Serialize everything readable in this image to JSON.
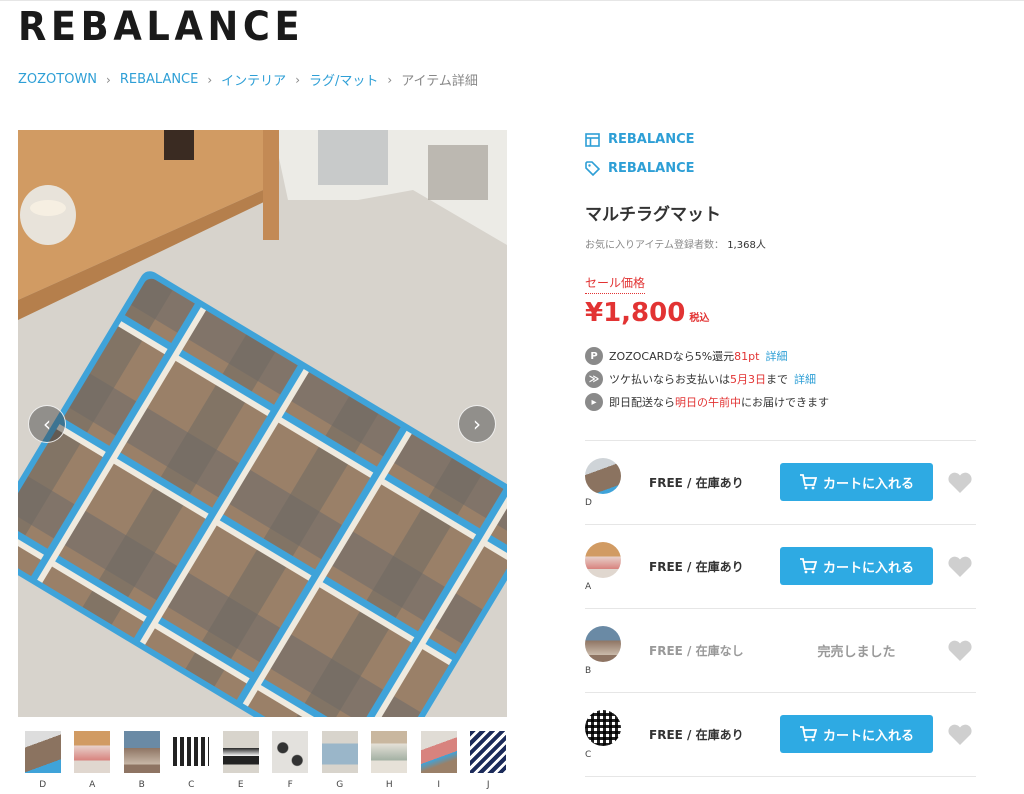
{
  "logo": "REBALANCE",
  "breadcrumb": {
    "items": [
      "ZOZOTOWN",
      "REBALANCE",
      "インテリア",
      "ラグ/マット"
    ],
    "separator": "›",
    "current": "アイテム詳細"
  },
  "gallery": {
    "prev_icon": "chevron-left-icon",
    "next_icon": "chevron-right-icon",
    "thumbnails": [
      "D",
      "A",
      "B",
      "C",
      "E",
      "F",
      "G",
      "H",
      "I",
      "J"
    ]
  },
  "product": {
    "shop_name": "REBALANCE",
    "brand_name": "REBALANCE",
    "title": "マルチラグマット",
    "favorites_label": "お気に入りアイテム登録者数：",
    "favorites_count": "1,368人",
    "sale_label": "セール価格",
    "price": "¥1,800",
    "tax_label": "税込"
  },
  "info": {
    "points": {
      "icon": "P",
      "pre": "ZOZOCARDなら5%還元",
      "highlight": "81pt",
      "link": "詳細"
    },
    "tsuke": {
      "pre": "ツケ払いならお支払いは",
      "highlight": "5月3日",
      "post": "まで",
      "link": "詳細"
    },
    "delivery": {
      "pre": "即日配送なら",
      "highlight": "明日の午前中",
      "post": "にお届けできます"
    }
  },
  "variants": [
    {
      "code": "D",
      "stock": "FREE / 在庫あり",
      "action": "カートに入れる",
      "soldout": false
    },
    {
      "code": "A",
      "stock": "FREE / 在庫あり",
      "action": "カートに入れる",
      "soldout": false
    },
    {
      "code": "B",
      "stock": "FREE / 在庫なし",
      "action": "完売しました",
      "soldout": true
    },
    {
      "code": "C",
      "stock": "FREE / 在庫あり",
      "action": "カートに入れる",
      "soldout": false
    }
  ],
  "colors": {
    "accent": "#2e9fd6",
    "button": "#2eaae3",
    "sale": "#e23333"
  }
}
